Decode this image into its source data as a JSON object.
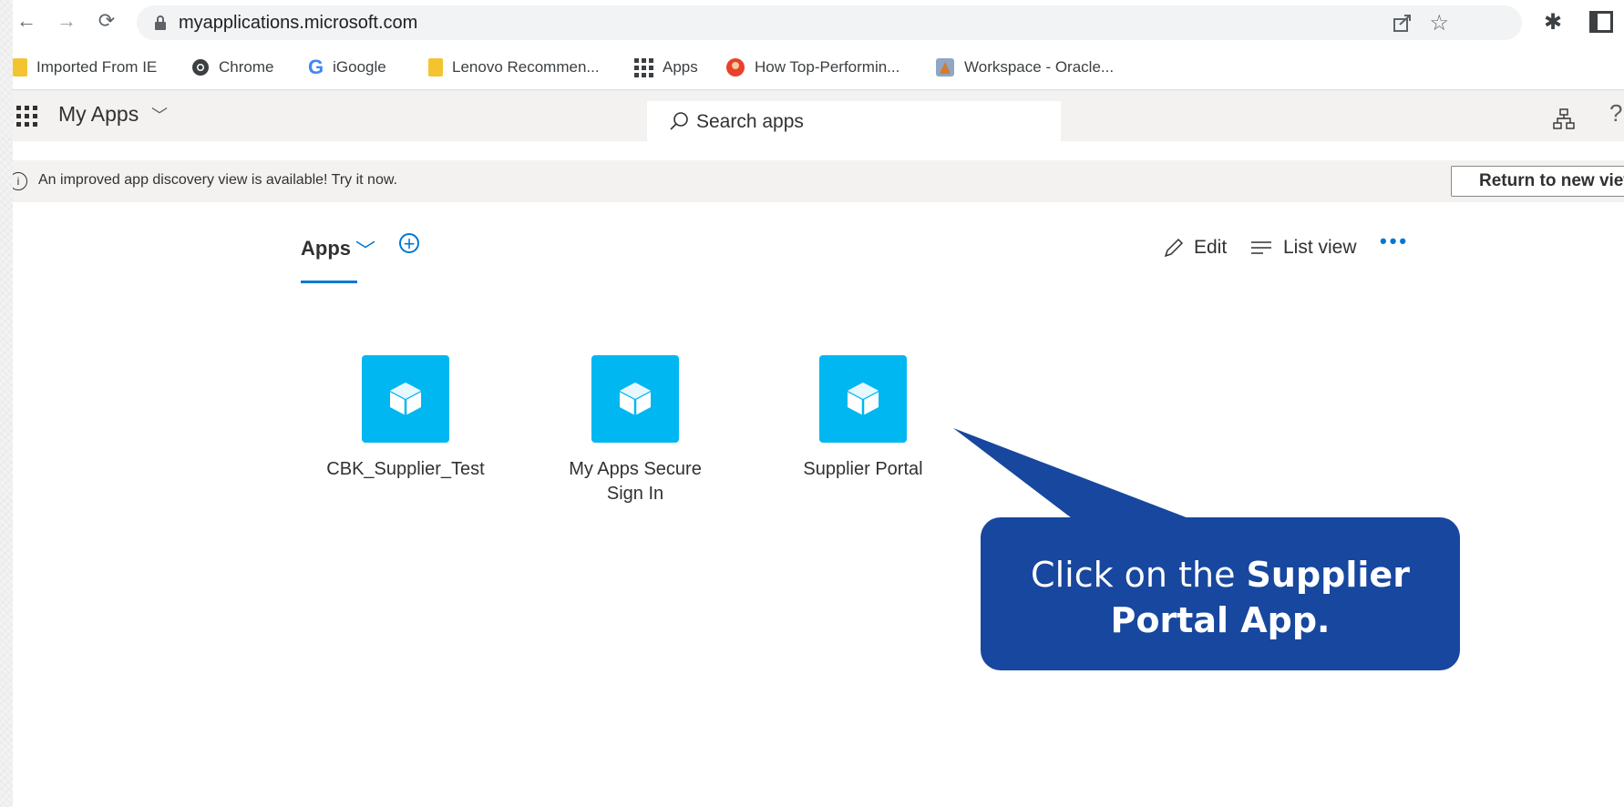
{
  "browser": {
    "url": "myapplications.microsoft.com",
    "bookmarks": [
      {
        "label": "Imported From IE",
        "icon": "folder-icon"
      },
      {
        "label": "Chrome",
        "icon": "chrome-icon"
      },
      {
        "label": "iGoogle",
        "icon": "google-g-icon"
      },
      {
        "label": "Lenovo Recommen...",
        "icon": "folder-icon"
      },
      {
        "label": "Apps",
        "icon": "apps-grid-icon"
      },
      {
        "label": "How Top-Performin...",
        "icon": "site-favicon-icon"
      },
      {
        "label": "Workspace - Oracle...",
        "icon": "oracle-favicon-icon"
      }
    ]
  },
  "header": {
    "title": "My Apps",
    "search_placeholder": "Search apps"
  },
  "banner": {
    "text": "An improved app discovery view is available! Try it now.",
    "button": "Return to new view"
  },
  "main": {
    "tab_label": "Apps",
    "edit_label": "Edit",
    "list_view_label": "List view",
    "more_label": "•••",
    "apps": [
      {
        "label": "CBK_Supplier_Test"
      },
      {
        "label": "My Apps Secure Sign In"
      },
      {
        "label": "Supplier Portal"
      }
    ]
  },
  "callout": {
    "text_plain": "Click on the",
    "text_bold": "Supplier Portal App."
  },
  "colors": {
    "accent": "#0078d4",
    "tile": "#00b7f1",
    "callout": "#17479e"
  }
}
